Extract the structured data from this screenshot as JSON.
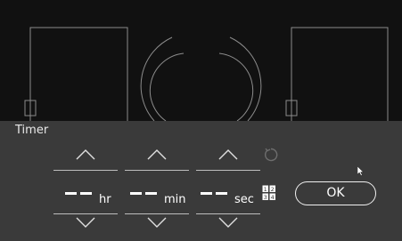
{
  "timer": {
    "title": "Timer",
    "hours": {
      "value": "– –",
      "unit": "hr"
    },
    "minutes": {
      "value": "– –",
      "unit": "min"
    },
    "seconds": {
      "value": "– –",
      "unit": "sec"
    },
    "ok_label": "OK",
    "keypad_digits": [
      "1",
      "2",
      "3",
      "4"
    ]
  },
  "colors": {
    "background": "#111111",
    "panel": "#3a3a3a",
    "line": "#bdbdbd",
    "text": "#ffffff"
  },
  "icons": [
    "chevron-up-icon",
    "chevron-down-icon",
    "reset-icon",
    "keypad-icon",
    "cursor-icon"
  ]
}
